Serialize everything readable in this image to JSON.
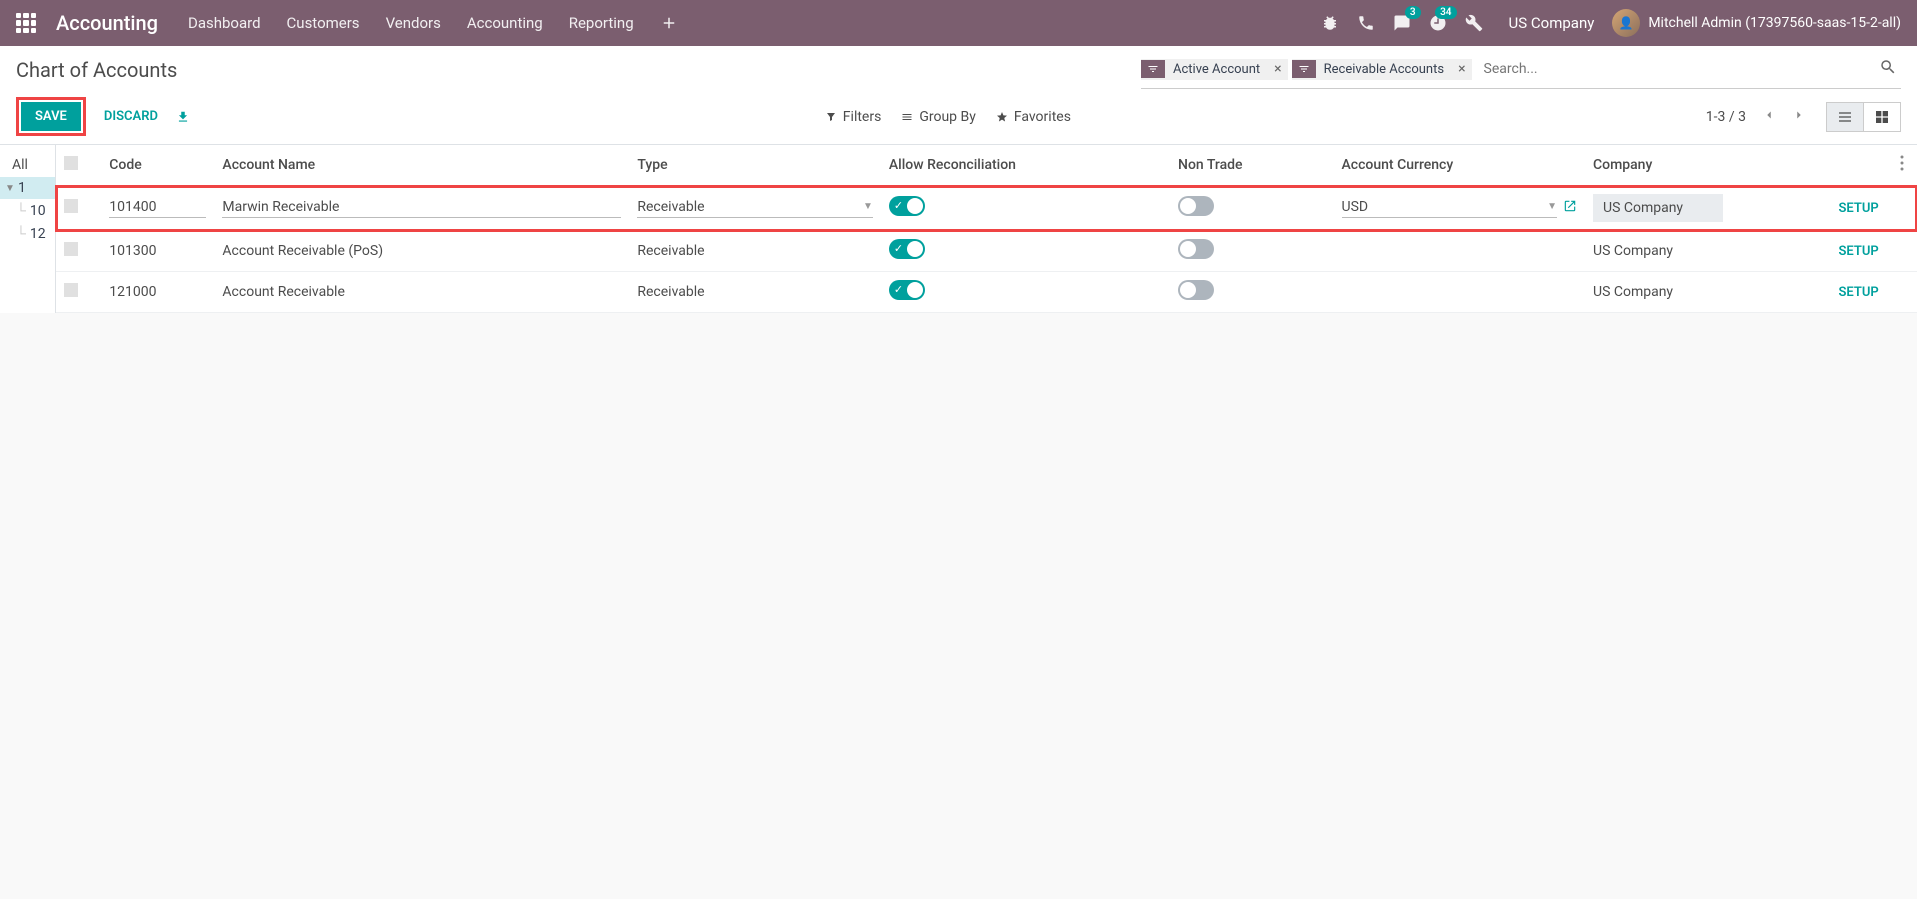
{
  "navbar": {
    "brand": "Accounting",
    "menu": [
      "Dashboard",
      "Customers",
      "Vendors",
      "Accounting",
      "Reporting"
    ],
    "chat_badge": "3",
    "activity_badge": "34",
    "company": "US Company",
    "user": "Mitchell Admin (17397560-saas-15-2-all)"
  },
  "control": {
    "title": "Chart of Accounts",
    "save": "SAVE",
    "discard": "DISCARD",
    "facets": [
      "Active Account",
      "Receivable Accounts"
    ],
    "search_placeholder": "Search...",
    "filters": "Filters",
    "groupby": "Group By",
    "favorites": "Favorites",
    "pager": "1-3 / 3"
  },
  "sidebar": {
    "all": "All",
    "items": [
      "1",
      "10",
      "12"
    ]
  },
  "table": {
    "headers": {
      "code": "Code",
      "name": "Account Name",
      "type": "Type",
      "recon": "Allow Reconciliation",
      "nontrade": "Non Trade",
      "currency": "Account Currency",
      "company": "Company"
    },
    "rows": [
      {
        "code": "101400",
        "name": "Marwin Receivable",
        "type": "Receivable",
        "recon": true,
        "nontrade": false,
        "currency": "USD",
        "company": "US Company",
        "setup": "SETUP",
        "editing": true
      },
      {
        "code": "101300",
        "name": "Account Receivable (PoS)",
        "type": "Receivable",
        "recon": true,
        "nontrade": false,
        "currency": "",
        "company": "US Company",
        "setup": "SETUP",
        "editing": false
      },
      {
        "code": "121000",
        "name": "Account Receivable",
        "type": "Receivable",
        "recon": true,
        "nontrade": false,
        "currency": "",
        "company": "US Company",
        "setup": "SETUP",
        "editing": false
      }
    ]
  }
}
